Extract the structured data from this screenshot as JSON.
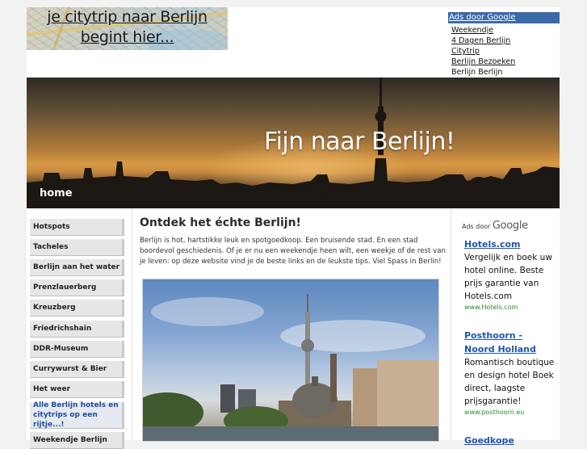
{
  "header": {
    "map_line1": "je citytrip naar Berlijn",
    "map_line2": "begint hier..."
  },
  "ads_top": {
    "header": "Ads door Google",
    "links": [
      "Weekendje",
      "4 Dagen Berlijn",
      "Citytrip",
      "Berlijn Bezoeken",
      "Berlijn Berlijn"
    ]
  },
  "hero": {
    "title": "Fijn naar Berlijn!",
    "home": "home"
  },
  "sidebar": {
    "items": [
      {
        "label": "Hotspots"
      },
      {
        "label": "Tacheles"
      },
      {
        "label": "Berlijn aan het water"
      },
      {
        "label": "Prenzlauerberg"
      },
      {
        "label": "Kreuzberg"
      },
      {
        "label": "Friedrichshain"
      },
      {
        "label": "DDR-Museum"
      },
      {
        "label": "Currywurst & Bier"
      },
      {
        "label": "Het weer"
      },
      {
        "label": "Alle Berlijn hotels en citytrips op een rijtje...!"
      },
      {
        "label": "Weekendje Berlijn"
      }
    ]
  },
  "main": {
    "title": "Ontdek het échte Berlijn!",
    "text": "Berlijn is hot, hartstikke leuk en spotgoedkoop. Een bruisende stad. En een stad boordevol geschiedenis. Of je er nu een weekendje heen wilt, een weekje of de rest van je leven: op deze website vind je de beste links en de leukste tips. Viel Spass in Berlin!"
  },
  "ads_right": {
    "ads_by": "Ads door",
    "brand": "Google",
    "ads": [
      {
        "title": "Hotels.com",
        "body": "Vergelijk en boek uw hotel online. Beste prijs garantie van Hotels.com",
        "url": "www.Hotels.com"
      },
      {
        "title": "Posthoorn - Noord Holland",
        "body": "Romantisch boutique en design hotel Boek direct, laagste prijsgarantie!",
        "url": "www.posthoorn.eu"
      },
      {
        "title": "Goedkope",
        "body": "",
        "url": ""
      }
    ]
  },
  "colors": {
    "ads_header_bg": "#3b6aa8",
    "ad_link": "#1f55b0",
    "ad_url": "#2a8a2a",
    "promo_link": "#1d4e9e"
  }
}
